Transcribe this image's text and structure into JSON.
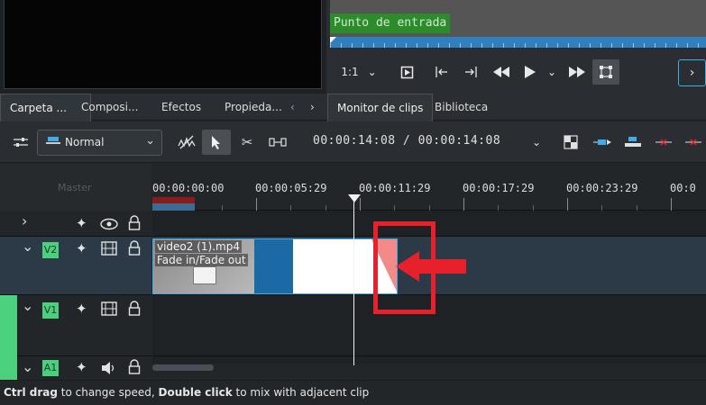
{
  "clip_monitor": {
    "in_point_label": "Punto de entrada",
    "zoom": "1:1"
  },
  "left_tabs": [
    {
      "label": "Carpeta ...",
      "selected": true
    },
    {
      "label": "Composi..."
    },
    {
      "label": "Efectos"
    },
    {
      "label": "Propieda..."
    }
  ],
  "right_tabs": [
    {
      "label": "Monitor de clips",
      "selected": true
    },
    {
      "label": "Biblioteca"
    }
  ],
  "toolbar": {
    "mode": "Normal",
    "timecode": "00:00:14:08 / 00:00:14:08"
  },
  "timeline": {
    "master_label": "Master",
    "ruler_labels": [
      "00:00:00:00",
      "00:00:05:29",
      "00:00:11:29",
      "00:00:17:29",
      "00:00:23:29",
      "00:0"
    ],
    "tracks": [
      {
        "label": "V2"
      },
      {
        "label": "V1"
      },
      {
        "label": "A1"
      }
    ],
    "clip": {
      "name": "video2 (1).mp4",
      "effect": "Fade in/Fade out"
    }
  },
  "status": {
    "key1": "Ctrl drag",
    "text1": " to change speed, ",
    "key2": "Double click",
    "text2": " to mix with adjacent clip"
  },
  "colors": {
    "accent": "#3daee9",
    "track_green": "#4bd07d",
    "annotation_red": "#e8202b",
    "in_point_green": "#2c8c2c"
  }
}
